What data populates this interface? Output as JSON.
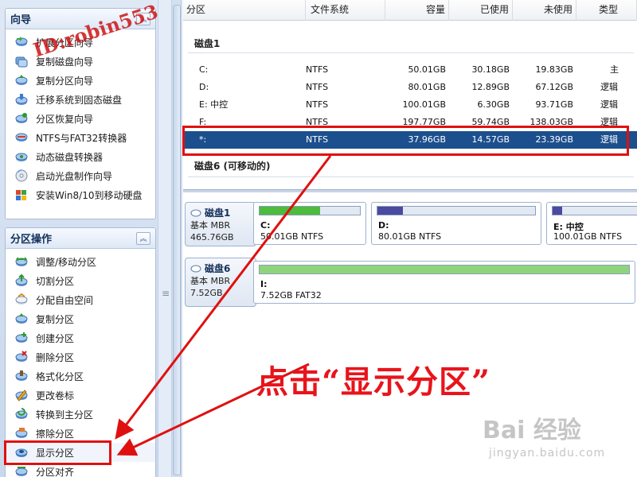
{
  "wizard_panel": {
    "title": "向导",
    "collapse_symbol": "︽",
    "items": [
      {
        "label": "扩展分区向导",
        "icon": "extend-partition-icon"
      },
      {
        "label": "复制磁盘向导",
        "icon": "copy-disk-icon"
      },
      {
        "label": "复制分区向导",
        "icon": "copy-partition-icon"
      },
      {
        "label": "迁移系统到固态磁盘",
        "icon": "migrate-os-icon"
      },
      {
        "label": "分区恢复向导",
        "icon": "recover-partition-icon"
      },
      {
        "label": "NTFS与FAT32转换器",
        "icon": "ntfs-fat32-converter-icon"
      },
      {
        "label": "动态磁盘转换器",
        "icon": "dynamic-disk-icon"
      },
      {
        "label": "启动光盘制作向导",
        "icon": "bootable-cd-icon"
      },
      {
        "label": "安装Win8/10到移动硬盘",
        "icon": "windows-to-go-icon"
      }
    ]
  },
  "partition_ops_panel": {
    "title": "分区操作",
    "collapse_symbol": "︽",
    "items": [
      {
        "label": "调整/移动分区",
        "icon": "resize-move-icon"
      },
      {
        "label": "切割分区",
        "icon": "split-partition-icon"
      },
      {
        "label": "分配自由空间",
        "icon": "allocate-space-icon"
      },
      {
        "label": "复制分区",
        "icon": "copy-partition-icon"
      },
      {
        "label": "创建分区",
        "icon": "create-partition-icon"
      },
      {
        "label": "删除分区",
        "icon": "delete-partition-icon"
      },
      {
        "label": "格式化分区",
        "icon": "format-partition-icon"
      },
      {
        "label": "更改卷标",
        "icon": "change-label-icon"
      },
      {
        "label": "转换到主分区",
        "icon": "convert-primary-icon"
      },
      {
        "label": "擦除分区",
        "icon": "wipe-partition-icon"
      },
      {
        "label": "显示分区",
        "icon": "unhide-partition-icon"
      },
      {
        "label": "分区对齐",
        "icon": "align-partition-icon"
      }
    ]
  },
  "splitter": {
    "grip": "≡"
  },
  "table": {
    "columns": [
      "分区",
      "文件系统",
      "容量",
      "已使用",
      "未使用",
      "类型"
    ],
    "disk1_label": "磁盘1",
    "disk6_label": "磁盘6 (可移动的)",
    "rows": [
      {
        "partition": "C:",
        "fs": "NTFS",
        "capacity": "50.01GB",
        "used": "30.18GB",
        "free": "19.83GB",
        "type": "主"
      },
      {
        "partition": "D:",
        "fs": "NTFS",
        "capacity": "80.01GB",
        "used": "12.89GB",
        "free": "67.12GB",
        "type": "逻辑"
      },
      {
        "partition": "E: 中控",
        "fs": "NTFS",
        "capacity": "100.01GB",
        "used": "6.30GB",
        "free": "93.71GB",
        "type": "逻辑"
      },
      {
        "partition": "F:",
        "fs": "NTFS",
        "capacity": "197.77GB",
        "used": "59.74GB",
        "free": "138.03GB",
        "type": "逻辑"
      },
      {
        "partition": "*:",
        "fs": "NTFS",
        "capacity": "37.96GB",
        "used": "14.57GB",
        "free": "23.39GB",
        "type": "逻辑"
      }
    ],
    "selected_row": 4
  },
  "disk_map": {
    "disks": [
      {
        "name": "磁盘1",
        "kind": "基本 MBR",
        "size": "465.76GB",
        "partitions": [
          {
            "label": "C:",
            "size_text": "50.01GB NTFS",
            "used_fraction": 0.6,
            "color": "#4dbb3c"
          },
          {
            "label": "D:",
            "size_text": "80.01GB NTFS",
            "used_fraction": 0.16,
            "color": "#4a4aa0"
          },
          {
            "label": "E: 中控",
            "size_text": "100.01GB NTFS",
            "used_fraction": 0.1,
            "color": "#4a4aa0"
          }
        ]
      },
      {
        "name": "磁盘6",
        "kind": "基本 MBR",
        "size": "7.52GB",
        "partitions": [
          {
            "label": "I:",
            "size_text": "7.52GB FAT32",
            "used_fraction": 1.0,
            "color": "#8fd47c"
          }
        ]
      }
    ]
  },
  "annotation": {
    "callout_text": "点击“显示分区”",
    "watermark_text": "ID:robin553",
    "highlight_color": "#e01010"
  },
  "baidu_watermark": {
    "logo_text": "Bai 经验",
    "url": "jingyan.baidu.com"
  }
}
